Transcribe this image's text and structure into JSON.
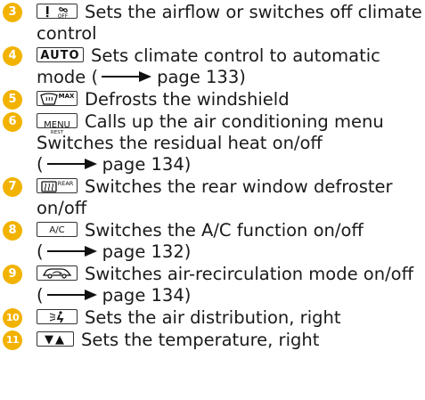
{
  "colors": {
    "bullet": "#f2b200",
    "text": "#1a1a1a"
  },
  "items": [
    {
      "number": "3",
      "button": {
        "icon": "fan-off-icon",
        "label": "OFF"
      },
      "lines": [
        "Sets the airflow or switches off climate",
        "control"
      ]
    },
    {
      "number": "4",
      "button": {
        "label": "AUTO"
      },
      "lines": [
        "Sets climate control to automatic",
        "mode ("
      ],
      "ref": {
        "page": "page 133)"
      }
    },
    {
      "number": "5",
      "button": {
        "icon": "windshield-defrost-icon",
        "label": "MAX"
      },
      "lines": [
        "Defrosts the windshield"
      ]
    },
    {
      "number": "6",
      "button": {
        "label": "MENU",
        "sublabel": "REST"
      },
      "lines": [
        "Calls up the air conditioning menu",
        "Switches the residual heat on/off",
        "("
      ],
      "ref": {
        "page": "page 134)"
      }
    },
    {
      "number": "7",
      "button": {
        "icon": "rear-window-defrost-icon",
        "label": "REAR"
      },
      "lines": [
        "Switches the rear window defroster",
        "on/off"
      ]
    },
    {
      "number": "8",
      "button": {
        "label": "A/C"
      },
      "lines": [
        "Switches the A/C function on/off",
        "("
      ],
      "ref": {
        "page": "page 132)"
      }
    },
    {
      "number": "9",
      "button": {
        "icon": "recirculation-icon"
      },
      "lines": [
        "Switches air-recirculation mode on/off",
        "("
      ],
      "ref": {
        "page": "page 134)"
      }
    },
    {
      "number": "10",
      "button": {
        "icon": "air-distribution-icon"
      },
      "lines": [
        "Sets the air distribution, right"
      ]
    },
    {
      "number": "11",
      "button": {
        "icon": "temperature-arrows-icon",
        "label": "▼▲"
      },
      "lines": [
        "Sets the temperature, right"
      ]
    }
  ]
}
